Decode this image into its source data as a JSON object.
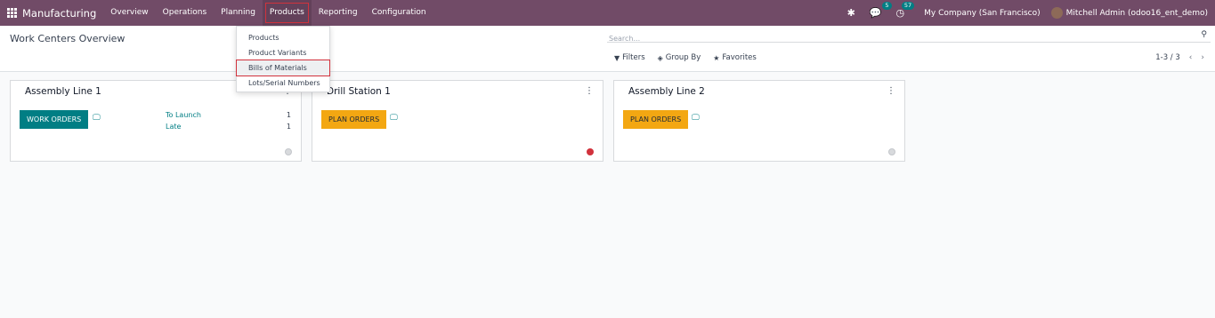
{
  "navbar": {
    "app_name": "Manufacturing",
    "menu": [
      "Overview",
      "Operations",
      "Planning",
      "Products",
      "Reporting",
      "Configuration"
    ],
    "active_menu": "Products",
    "messages_badge": "5",
    "activities_badge": "57",
    "company": "My Company (San Francisco)",
    "user": "Mitchell Admin (odoo16_ent_demo)"
  },
  "products_dropdown": {
    "items": [
      "Products",
      "Product Variants",
      "Bills of Materials",
      "Lots/Serial Numbers"
    ],
    "highlighted": "Bills of Materials"
  },
  "control_panel": {
    "title": "Work Centers Overview",
    "search_placeholder": "Search...",
    "filters_label": "Filters",
    "group_by_label": "Group By",
    "favorites_label": "Favorites",
    "pager": "1-3 / 3"
  },
  "cards": [
    {
      "title": "Assembly Line 1",
      "button": "WORK ORDERS",
      "stats": [
        {
          "label": "To Launch",
          "value": "1"
        },
        {
          "label": "Late",
          "value": "1"
        }
      ],
      "status": "grey"
    },
    {
      "title": "Drill Station 1",
      "button": "PLAN ORDERS",
      "status": "red"
    },
    {
      "title": "Assembly Line 2",
      "button": "PLAN ORDERS",
      "status": "grey"
    }
  ],
  "colors": {
    "navbar": "#714B67",
    "teal": "#017e84",
    "plan_orders": "#f3a712",
    "highlight_outline": "#d1323c"
  }
}
